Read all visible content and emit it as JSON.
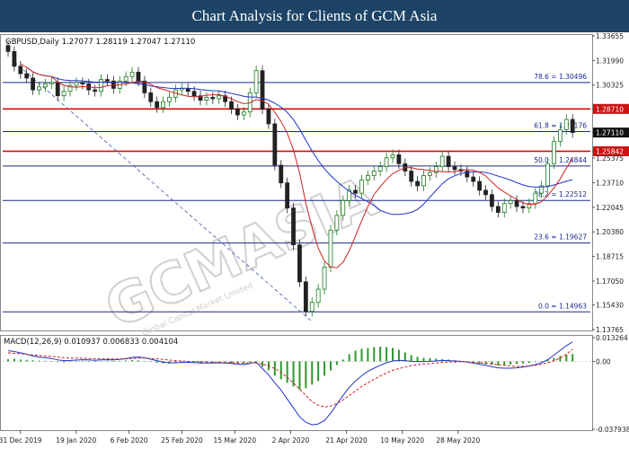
{
  "header": {
    "title": "Chart Analysis for Clients of GCM Asia"
  },
  "watermark": {
    "text": "GCMASIA",
    "subtext": "Global Capital Market Limited"
  },
  "chart_data": [
    {
      "type": "candlestick",
      "title": "GBPUSD,Daily  1.27077 1.28119 1.27047 1.27110",
      "ylim": [
        1.13765,
        1.33655
      ],
      "y_ticks": [
        "1.33655",
        "1.31990",
        "1.30325",
        "1.28710",
        "1.27110",
        "1.25842",
        "1.25375",
        "1.23710",
        "1.22045",
        "1.20380",
        "1.18715",
        "1.17050",
        "1.15430",
        "1.13765"
      ],
      "x_ticks": [
        "31 Dec 2019",
        "19 Jan 2020",
        "6 Feb 2020",
        "25 Feb 2020",
        "15 Mar 2020",
        "2 Apr 2020",
        "21 Apr 2020",
        "10 May 2020",
        "28 May 2020"
      ],
      "fib_levels": [
        {
          "label": "78.6 = 1.30496",
          "value": 1.30496
        },
        {
          "label": "61.8 = 1.27176",
          "value": 1.27176
        },
        {
          "label": "50.0 = 1.24844",
          "value": 1.24844
        },
        {
          "label": "38.2 = 1.22512",
          "value": 1.22512
        },
        {
          "label": "23.6 = 1.19627",
          "value": 1.19627
        },
        {
          "label": "0.0 = 1.14963",
          "value": 1.14963
        }
      ],
      "resistance_levels": [
        {
          "label": "1.28710",
          "value": 1.2871
        },
        {
          "label": "1.25842",
          "value": 1.25842
        }
      ],
      "current_price": "1.27110",
      "colors": {
        "up": "#1a7a1a",
        "down": "#222222",
        "ma_fast": "#cc2222",
        "ma_slow": "#2233cc",
        "fib": "#1a2a8a",
        "resistance": "#cc1111"
      },
      "closes": [
        1.326,
        1.316,
        1.311,
        1.308,
        1.3,
        1.302,
        1.304,
        1.305,
        1.296,
        1.299,
        1.303,
        1.305,
        1.304,
        1.3,
        1.299,
        1.307,
        1.306,
        1.301,
        1.306,
        1.309,
        1.312,
        1.306,
        1.298,
        1.292,
        1.288,
        1.292,
        1.295,
        1.3,
        1.301,
        1.299,
        1.296,
        1.293,
        1.295,
        1.294,
        1.296,
        1.292,
        1.287,
        1.283,
        1.285,
        1.298,
        1.313,
        1.287,
        1.277,
        1.249,
        1.237,
        1.22,
        1.195,
        1.17,
        1.15,
        1.156,
        1.165,
        1.18,
        1.205,
        1.215,
        1.225,
        1.232,
        1.23,
        1.239,
        1.242,
        1.245,
        1.248,
        1.254,
        1.256,
        1.25,
        1.245,
        1.238,
        1.235,
        1.242,
        1.244,
        1.248,
        1.255,
        1.248,
        1.246,
        1.245,
        1.241,
        1.238,
        1.232,
        1.229,
        1.221,
        1.217,
        1.223,
        1.225,
        1.221,
        1.22,
        1.223,
        1.23,
        1.235,
        1.25,
        1.265,
        1.273,
        1.28,
        1.2711
      ],
      "macd": {
        "label": "MACD(12,26,9) 0.010937 0.006833 0.004104",
        "ylim": [
          -0.037938,
          0.013264
        ],
        "y_ticks": [
          "0.013264",
          "0.00",
          "-0.037938"
        ],
        "hist": [
          0.0012,
          0.0015,
          0.001,
          0.0008,
          0.0006,
          0.0004,
          0.0003,
          0.0002,
          -0.0004,
          -0.0006,
          -0.0003,
          -0.0001,
          0.0002,
          0.0001,
          -0.0001,
          -0.0003,
          -0.0002,
          0.0001,
          0.0003,
          0.0005,
          0.0007,
          0.0006,
          0.0002,
          -0.0003,
          -0.0008,
          -0.0012,
          -0.0013,
          -0.001,
          -0.0008,
          -0.0007,
          -0.0007,
          -0.0008,
          -0.0008,
          -0.0007,
          -0.0006,
          -0.0007,
          -0.0009,
          -0.0012,
          -0.0013,
          -0.0008,
          -0.0002,
          -0.003,
          -0.005,
          -0.008,
          -0.01,
          -0.012,
          -0.014,
          -0.016,
          -0.015,
          -0.013,
          -0.011,
          -0.008,
          -0.005,
          -0.002,
          0.001,
          0.004,
          0.006,
          0.007,
          0.0075,
          0.008,
          0.0082,
          0.008,
          0.0075,
          0.0065,
          0.005,
          0.0035,
          0.0025,
          0.002,
          0.0018,
          0.0015,
          0.0012,
          0.001,
          0.0006,
          0.0002,
          -0.0003,
          -0.0008,
          -0.0012,
          -0.0016,
          -0.002,
          -0.0024,
          -0.0022,
          -0.0018,
          -0.0015,
          -0.0012,
          -0.0008,
          -0.0004,
          0.0002,
          0.001,
          0.002,
          0.003,
          0.0038,
          0.0041
        ],
        "macd_line": [
          0.006,
          0.0055,
          0.0048,
          0.004,
          0.003,
          0.0024,
          0.002,
          0.0016,
          0.0008,
          0.0004,
          0.0005,
          0.0007,
          0.0009,
          0.0008,
          0.0006,
          0.0008,
          0.0009,
          0.0008,
          0.0011,
          0.0016,
          0.0022,
          0.0024,
          0.002,
          0.0012,
          0.0004,
          -0.0004,
          -0.0008,
          -0.0008,
          -0.0006,
          -0.0006,
          -0.0007,
          -0.0009,
          -0.0009,
          -0.0009,
          -0.0008,
          -0.0009,
          -0.0012,
          -0.0016,
          -0.0018,
          -0.0012,
          -0.0004,
          -0.004,
          -0.0075,
          -0.012,
          -0.016,
          -0.021,
          -0.026,
          -0.031,
          -0.034,
          -0.0355,
          -0.035,
          -0.033,
          -0.029,
          -0.024,
          -0.019,
          -0.0145,
          -0.011,
          -0.008,
          -0.0056,
          -0.0038,
          -0.0022,
          -0.0008,
          0.0002,
          0.0006,
          0.0004,
          0.0,
          -0.0002,
          -0.0001,
          0.0,
          0.0002,
          0.0005,
          0.0004,
          0.0002,
          0.0,
          -0.0004,
          -0.001,
          -0.0016,
          -0.0022,
          -0.003,
          -0.0036,
          -0.0038,
          -0.0038,
          -0.0036,
          -0.0032,
          -0.0026,
          -0.0018,
          -0.0008,
          0.001,
          0.0035,
          0.0062,
          0.0088,
          0.0109
        ],
        "signal_line": [
          0.0048,
          0.0045,
          0.0043,
          0.004,
          0.0036,
          0.0033,
          0.003,
          0.0028,
          0.0024,
          0.002,
          0.0018,
          0.0018,
          0.0017,
          0.0016,
          0.0015,
          0.0014,
          0.0014,
          0.0013,
          0.0013,
          0.0014,
          0.0016,
          0.0018,
          0.0018,
          0.0016,
          0.0014,
          0.0011,
          0.0007,
          0.0004,
          0.0002,
          0.0,
          -0.0001,
          -0.0002,
          -0.0004,
          -0.0005,
          -0.0006,
          -0.0006,
          -0.0007,
          -0.0009,
          -0.001,
          -0.001,
          -0.0009,
          -0.0015,
          -0.0025,
          -0.004,
          -0.006,
          -0.009,
          -0.012,
          -0.0155,
          -0.019,
          -0.0225,
          -0.0245,
          -0.0255,
          -0.025,
          -0.0235,
          -0.0215,
          -0.019,
          -0.0165,
          -0.014,
          -0.012,
          -0.01,
          -0.0082,
          -0.0065,
          -0.005,
          -0.004,
          -0.0032,
          -0.0024,
          -0.0019,
          -0.0015,
          -0.0012,
          -0.0009,
          -0.0006,
          -0.0004,
          -0.0003,
          -0.0002,
          -0.0003,
          -0.0005,
          -0.0008,
          -0.001,
          -0.0014,
          -0.0018,
          -0.0022,
          -0.0026,
          -0.0028,
          -0.0028,
          -0.0026,
          -0.0022,
          -0.0016,
          -0.0008,
          0.0004,
          0.0018,
          0.004,
          0.0068
        ]
      }
    }
  ]
}
